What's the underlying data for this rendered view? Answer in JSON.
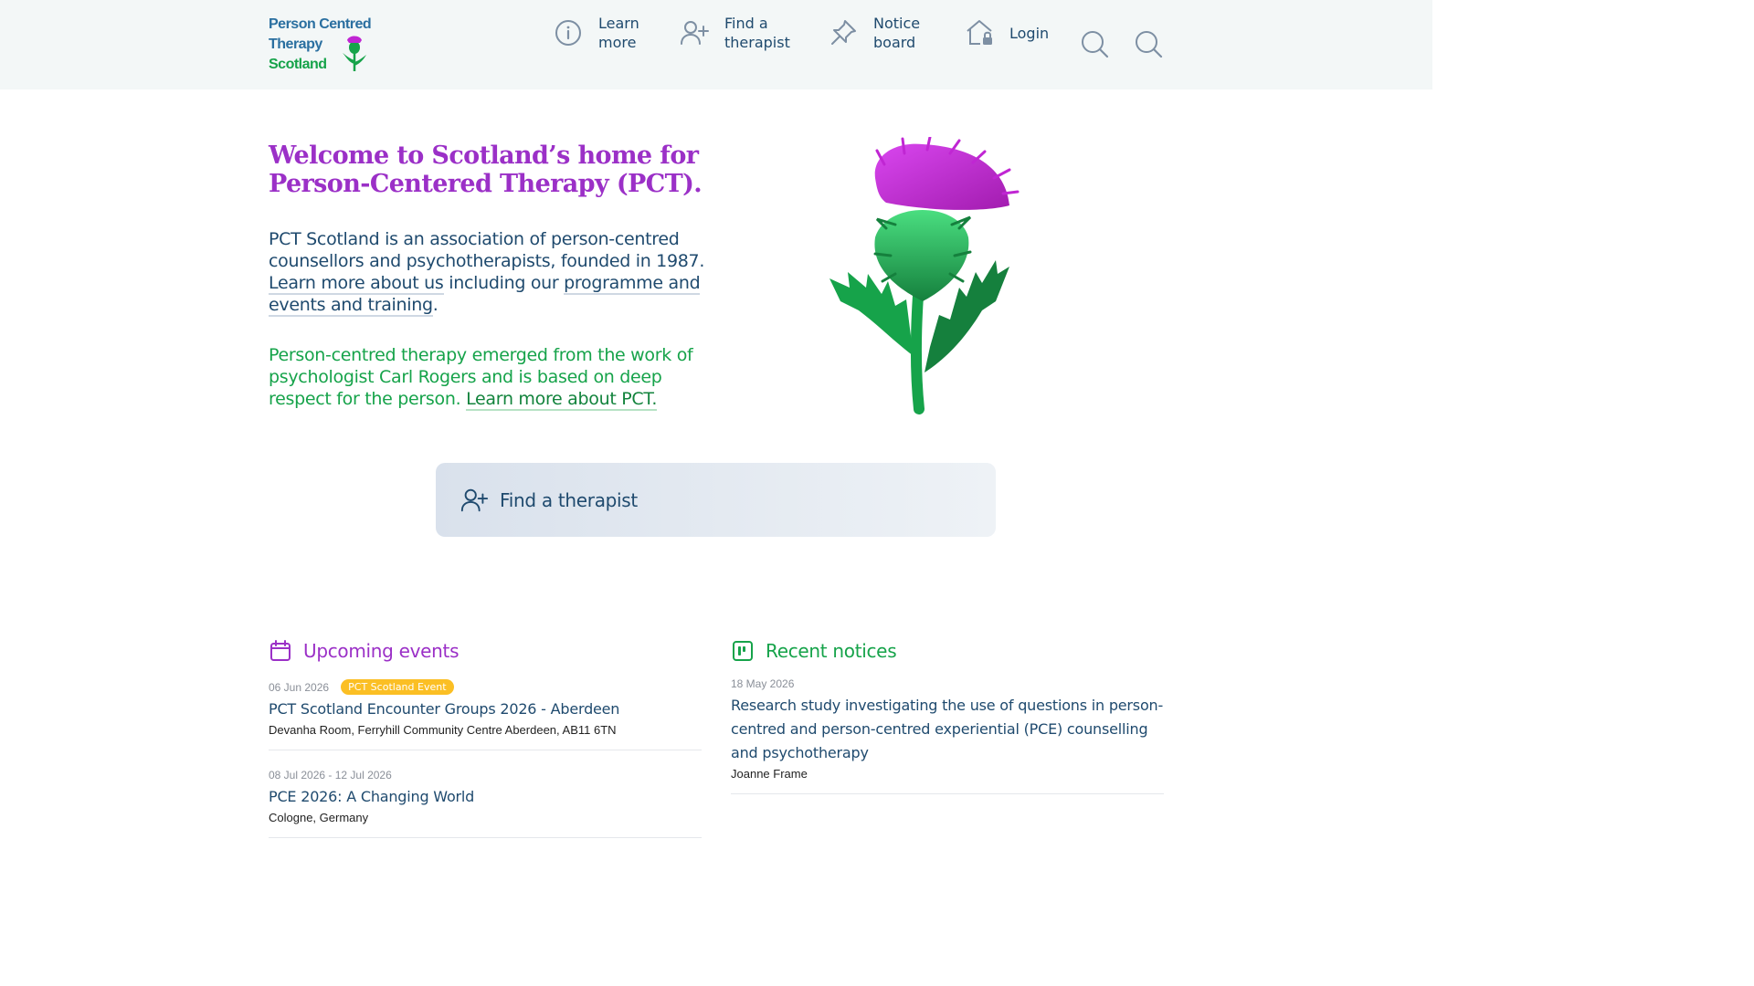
{
  "header": {
    "logo": {
      "line1": "Person Centred",
      "line2": "Therapy",
      "line3": "Scotland"
    },
    "nav": [
      {
        "label": "Learn more",
        "icon": "info-icon"
      },
      {
        "label": "Find a therapist",
        "icon": "user-plus-icon"
      },
      {
        "label": "Notice board",
        "icon": "pin-icon"
      },
      {
        "label": "Login",
        "icon": "home-lock-icon"
      }
    ],
    "search_icons": [
      "search-icon",
      "search-icon"
    ]
  },
  "hero": {
    "title": "Welcome to Scotland’s home for Person-Centered Therapy (PCT).",
    "p1_text": "PCT Scotland is an association of person-centred counsellors and psychotherapists, founded in 1987.",
    "p1_link1": "Learn more about us",
    "p1_mid": "including our",
    "p1_link2": "programme and events and training",
    "p1_end": ".",
    "p2_text": "Person-centred therapy emerged from the work of psychologist Carl Rogers and is based on deep respect for the person.",
    "p2_link": "Learn more about PCT."
  },
  "find_bar": {
    "label": "Find a therapist",
    "icon": "user-plus-icon"
  },
  "events": {
    "title": "Upcoming events",
    "icon": "calendar-icon",
    "items": [
      {
        "date": "06 Jun 2026",
        "badge": "PCT Scotland Event",
        "title": "PCT Scotland Encounter Groups 2026 - Aberdeen",
        "location": "Devanha Room, Ferryhill Community Centre Aberdeen, AB11 6TN"
      },
      {
        "date": "08 Jul 2026 - 12 Jul 2026",
        "badge": "",
        "title": "PCE 2026: A Changing World",
        "location": "Cologne, Germany"
      }
    ]
  },
  "notices": {
    "title": "Recent notices",
    "icon": "board-icon",
    "items": [
      {
        "date": "18 May 2026",
        "title": "Research study investigating the use of questions in person-centred and person-centred experiential (PCE) counselling and psychotherapy",
        "author": "Joanne Frame"
      }
    ]
  },
  "colors": {
    "purple": "#9b30c7",
    "green": "#16a34a",
    "navy": "#1f4a6e",
    "badge": "#fbbf24",
    "header_bg": "#f3f7f7"
  }
}
